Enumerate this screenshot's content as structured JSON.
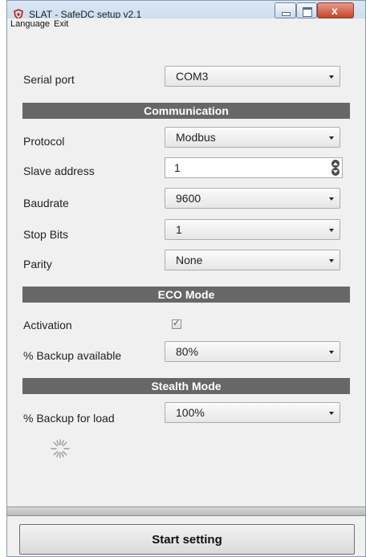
{
  "window": {
    "title": "SLAT - SafeDC setup v2.1"
  },
  "menu": {
    "items": [
      "Language",
      "Exit"
    ]
  },
  "icons": {
    "app": "app-shield-icon",
    "minimize": "minimize-icon",
    "maximize": "maximize-icon",
    "close": "close-icon",
    "spinner": "loading-spinner-icon"
  },
  "colors": {
    "section_header": "#676767",
    "close_button": "#c6452a"
  },
  "fields": {
    "serial_port": {
      "label": "Serial port",
      "value": "COM3"
    },
    "protocol": {
      "label": "Protocol",
      "value": "Modbus"
    },
    "slave_address": {
      "label": "Slave address",
      "value": "1"
    },
    "baudrate": {
      "label": "Baudrate",
      "value": "9600"
    },
    "stop_bits": {
      "label": "Stop Bits",
      "value": "1"
    },
    "parity": {
      "label": "Parity",
      "value": "None"
    },
    "activation": {
      "label": "Activation",
      "checked": true,
      "mark": "✓"
    },
    "backup_available": {
      "label": "% Backup available",
      "value": "80%"
    },
    "backup_for_load": {
      "label": "% Backup for load",
      "value": "100%"
    }
  },
  "sections": {
    "communication": "Communication",
    "eco_mode": "ECO Mode",
    "stealth_mode": "Stealth Mode"
  },
  "actions": {
    "start": "Start setting"
  }
}
